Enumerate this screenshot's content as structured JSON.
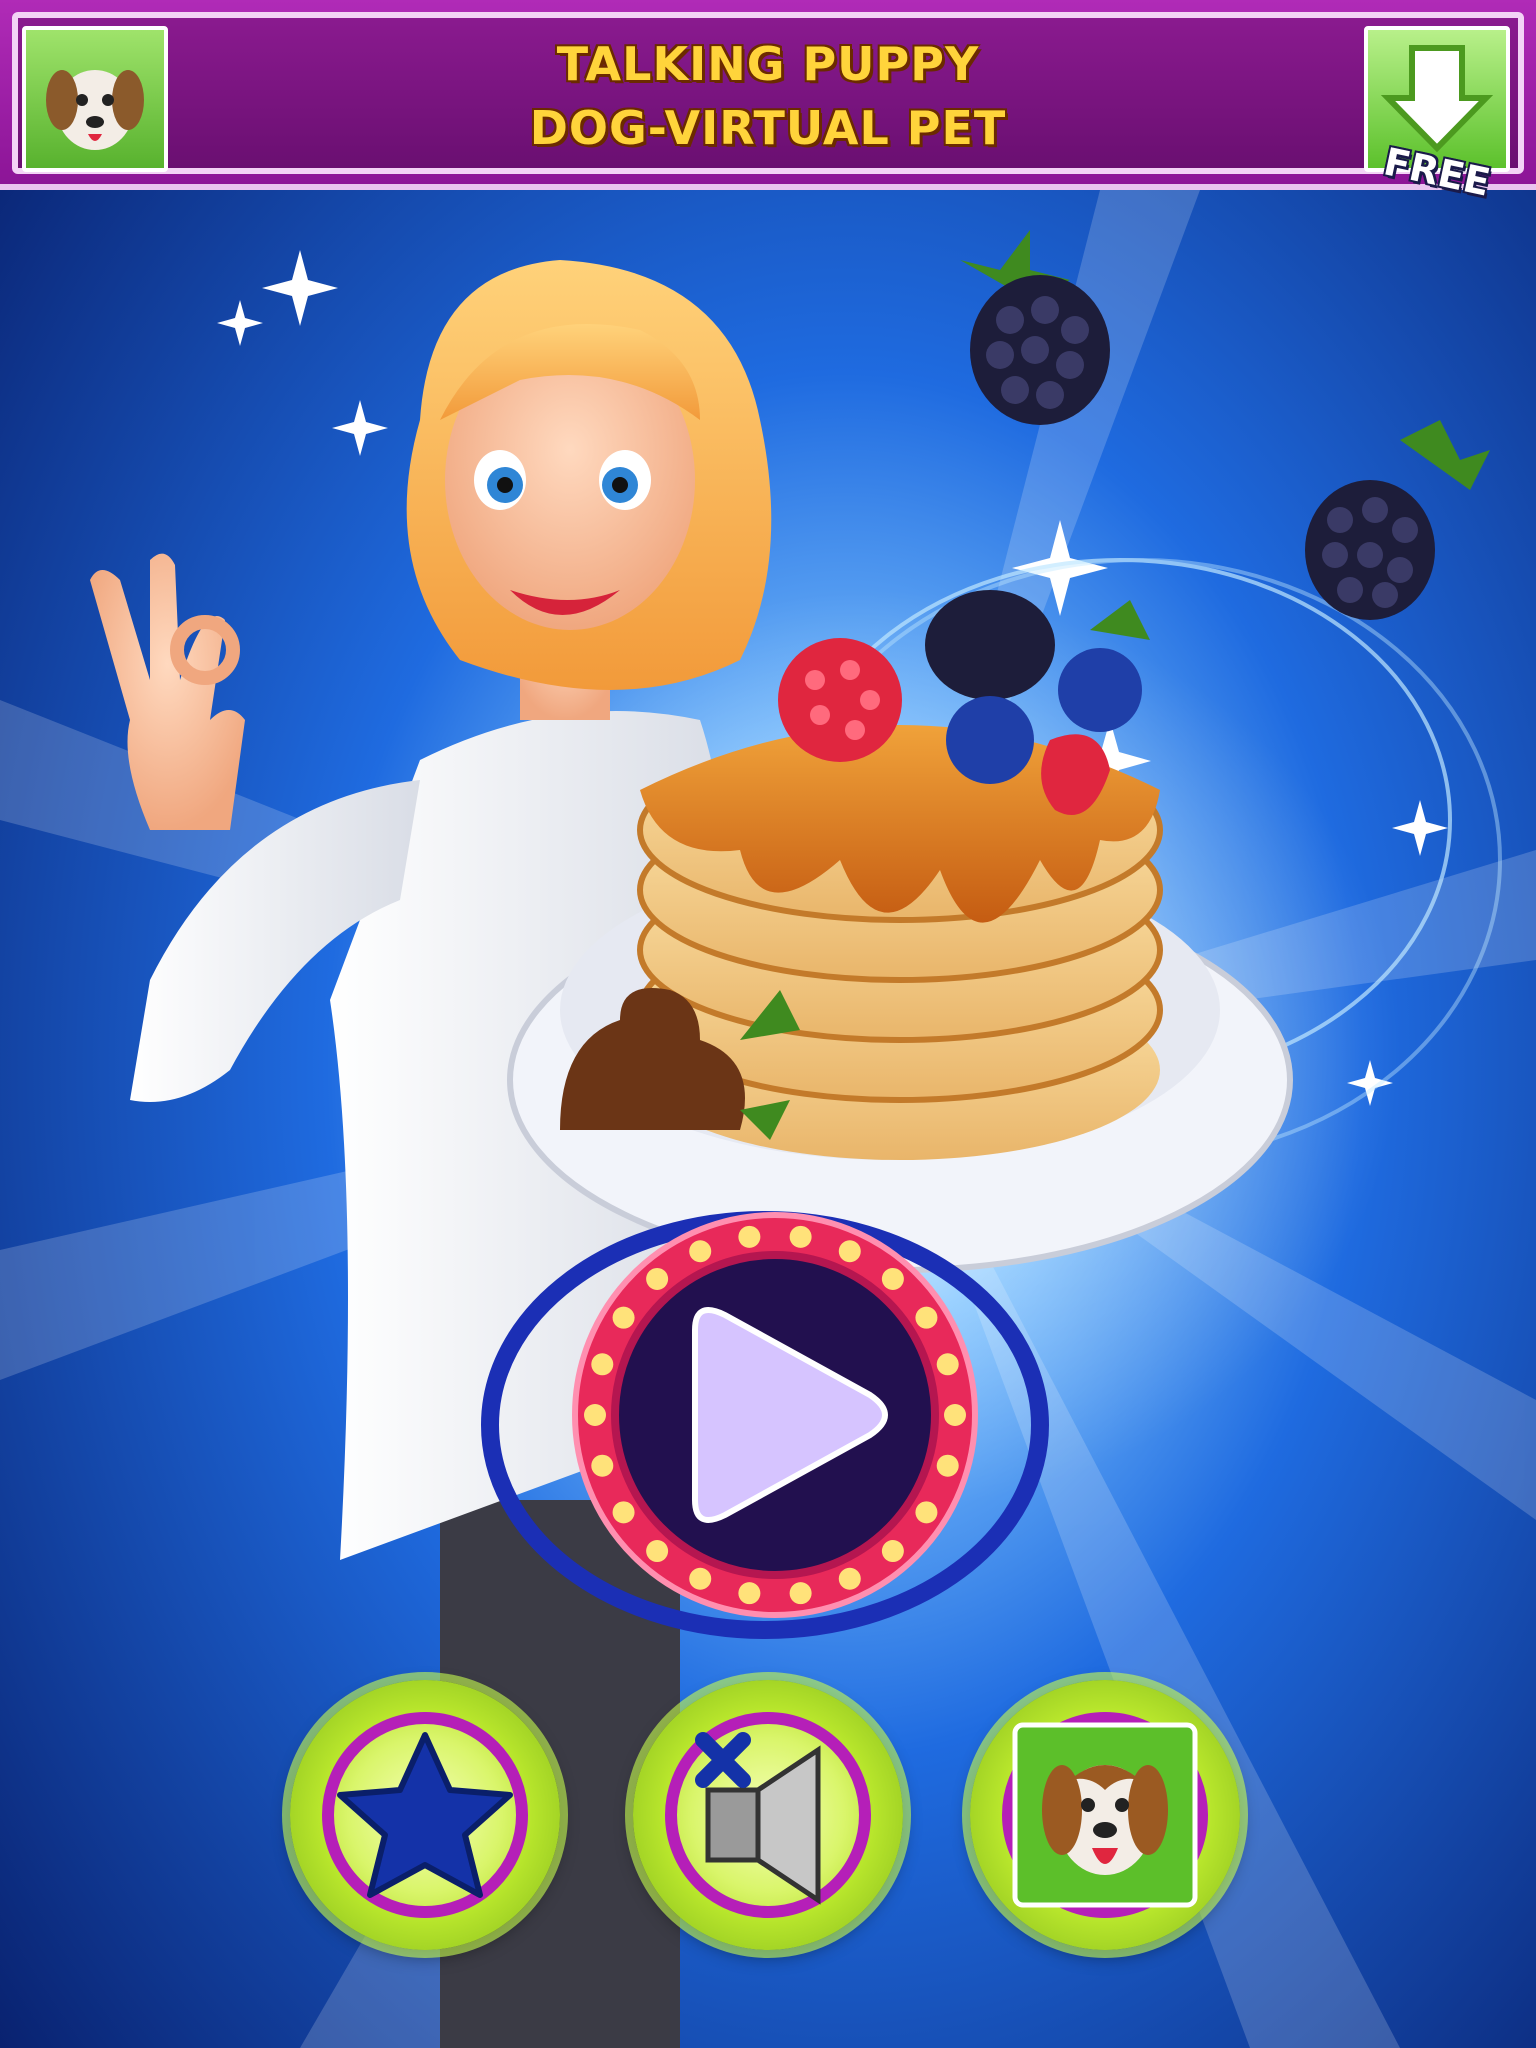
{
  "ad_banner": {
    "title_line1": "TALKING PUPPY",
    "title_line2": "DOG-VIRTUAL PET",
    "badge": "FREE",
    "thumbnail_icon": "puppy-icon",
    "download_icon": "download-arrow-icon"
  },
  "main": {
    "play_icon": "play-icon"
  },
  "bottom_buttons": [
    {
      "id": "rate",
      "icon": "star-icon"
    },
    {
      "id": "sound",
      "icon": "speaker-muted-icon"
    },
    {
      "id": "more-games",
      "icon": "puppy-icon"
    }
  ],
  "colors": {
    "banner": "#8c1597",
    "banner_text": "#ffd43b",
    "play_ring": "#e8295a",
    "button_ring": "#b51fb8",
    "button_fill": "#d9f56a",
    "background": "#0b2f8a"
  }
}
